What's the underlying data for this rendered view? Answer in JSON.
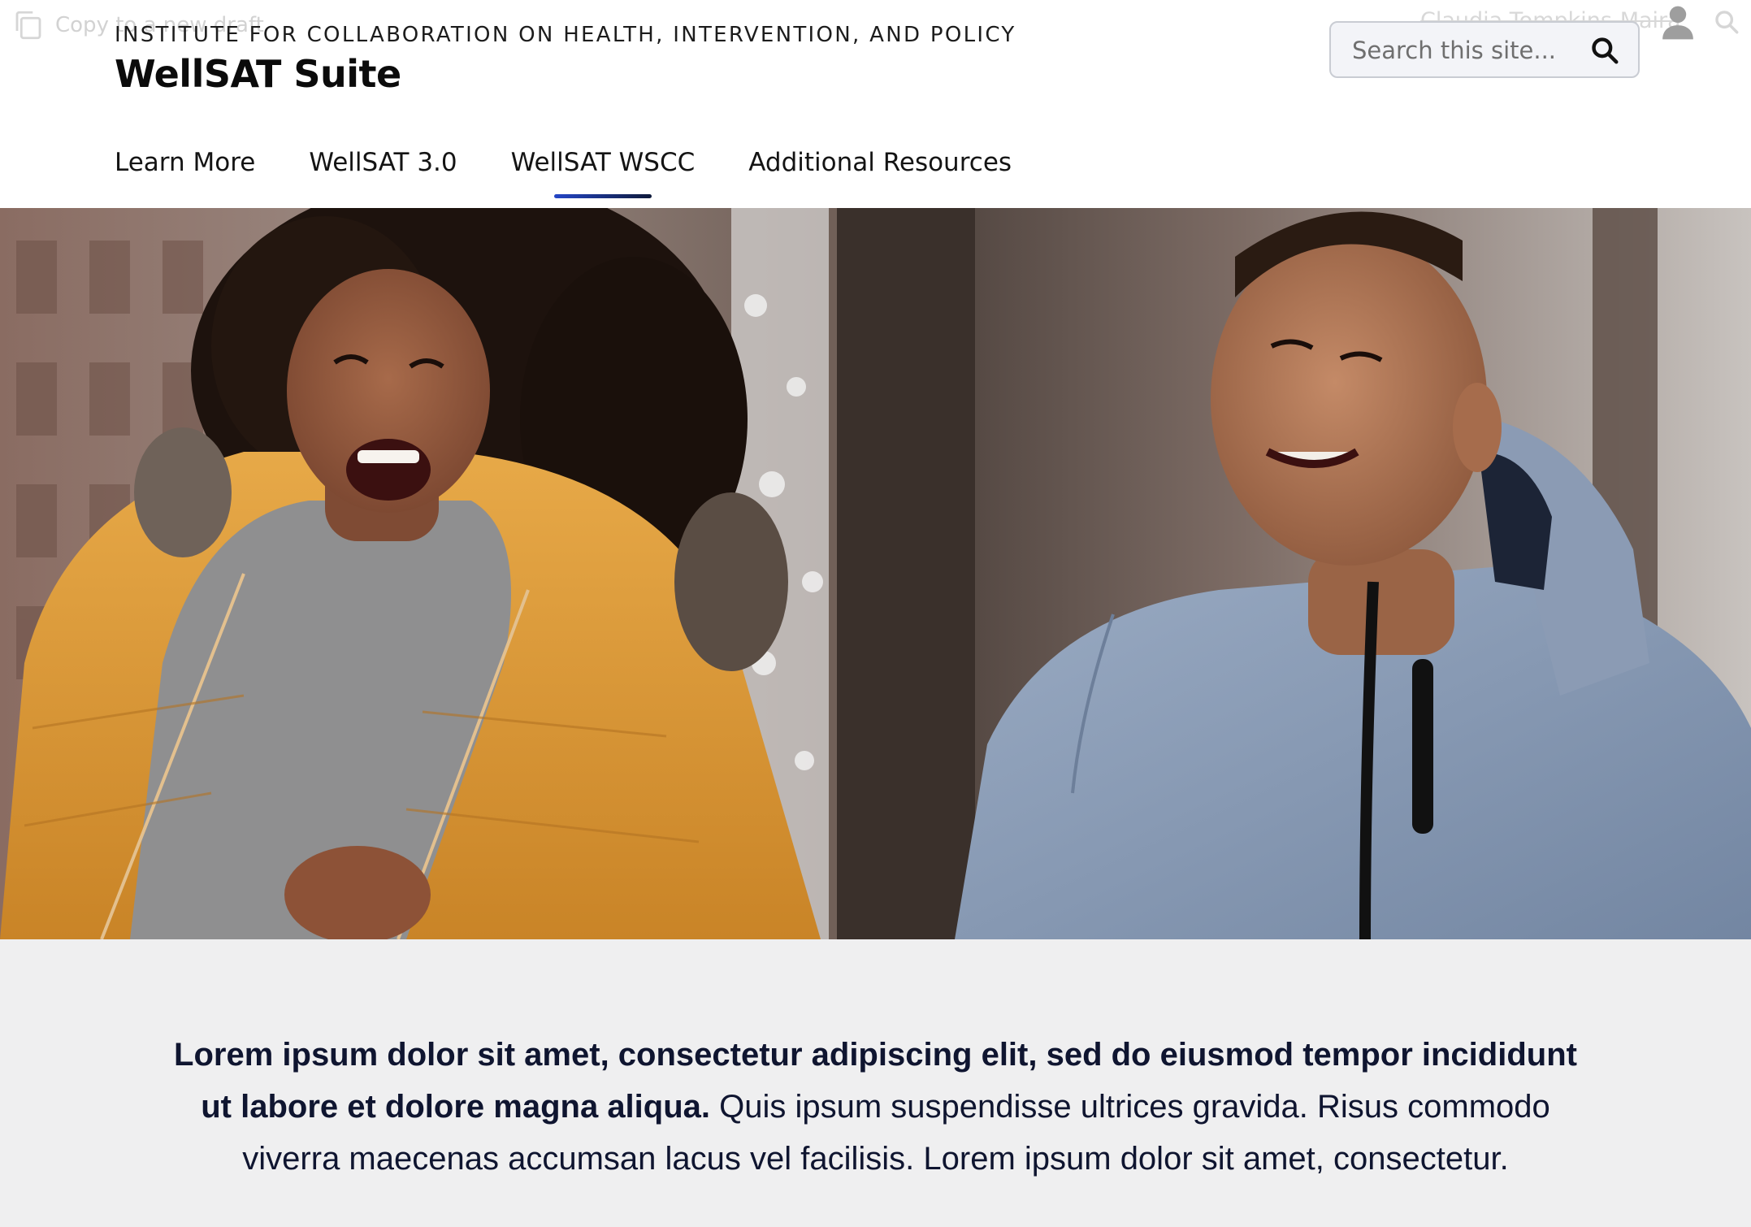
{
  "ghost": {
    "copy_label": "Copy to a new draft",
    "user_name": "Claudia Tompkins-Maira"
  },
  "header": {
    "org_name": "INSTITUTE FOR COLLABORATION ON HEALTH, INTERVENTION, AND POLICY",
    "site_title": "WellSAT Suite"
  },
  "search": {
    "placeholder": "Search this site..."
  },
  "nav": {
    "items": [
      {
        "label": "Learn More"
      },
      {
        "label": "WellSAT 3.0"
      },
      {
        "label": "WellSAT WSCC",
        "active": true
      },
      {
        "label": "Additional Resources"
      }
    ]
  },
  "hero": {
    "description": "Photo of two people jogging outdoors in winter"
  },
  "intro": {
    "bold": "Lorem ipsum dolor sit amet, consectetur adipiscing elit, sed do eiusmod tempor incididunt ut labore et dolore magna aliqua.",
    "regular": " Quis ipsum suspendisse ultrices gravida. Risus commodo viverra maecenas accumsan lacus vel facilisis. Lorem ipsum dolor sit amet, consectetur."
  },
  "colors": {
    "accent": "#2446c7",
    "intro_bg": "#efeff0",
    "text_dark": "#0f1530"
  },
  "icons": [
    "copy-icon",
    "search-icon",
    "user-icon"
  ]
}
